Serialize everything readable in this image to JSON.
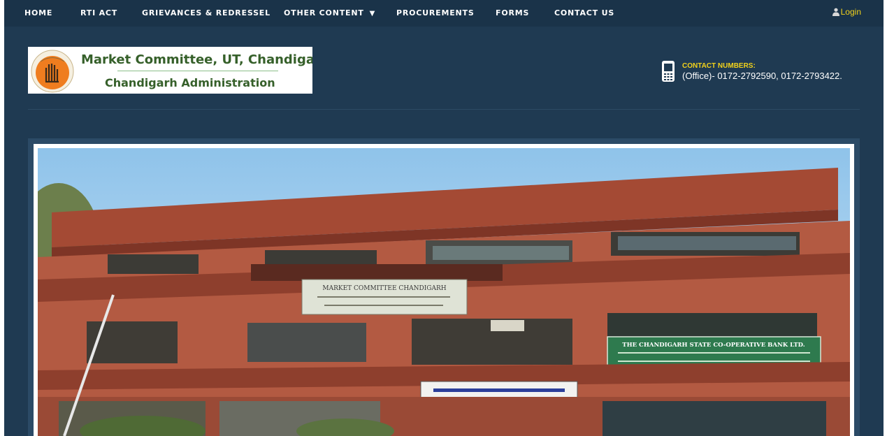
{
  "nav": {
    "items": [
      "HOME",
      "RTI ACT",
      "GRIEVANCES & REDRESSEL",
      "OTHER CONTENT",
      "PROCUREMENTS",
      "FORMS",
      "CONTACT US"
    ],
    "login": "Login"
  },
  "header": {
    "logo_line1": "Market Committee, UT, Chandigarh",
    "logo_line2": "Chandigarh Administration",
    "contact_title": "CONTACT NUMBERS:",
    "contact_value": "(Office)- 0172-2792590, 0172-2793422."
  },
  "slide": {
    "signs": {
      "market_committee": "MARKET COMMITTEE CHANDIGARH",
      "bank_line1": "THE CHANDIGARH STATE CO-OPERATIVE BANK LTD."
    }
  },
  "colors": {
    "page_bg": "#1f3a52",
    "nav_bg": "#1a3349",
    "accent_yellow": "#f2d21b",
    "logo_green": "#36602a",
    "emblem_orange": "#ef7d1f"
  }
}
